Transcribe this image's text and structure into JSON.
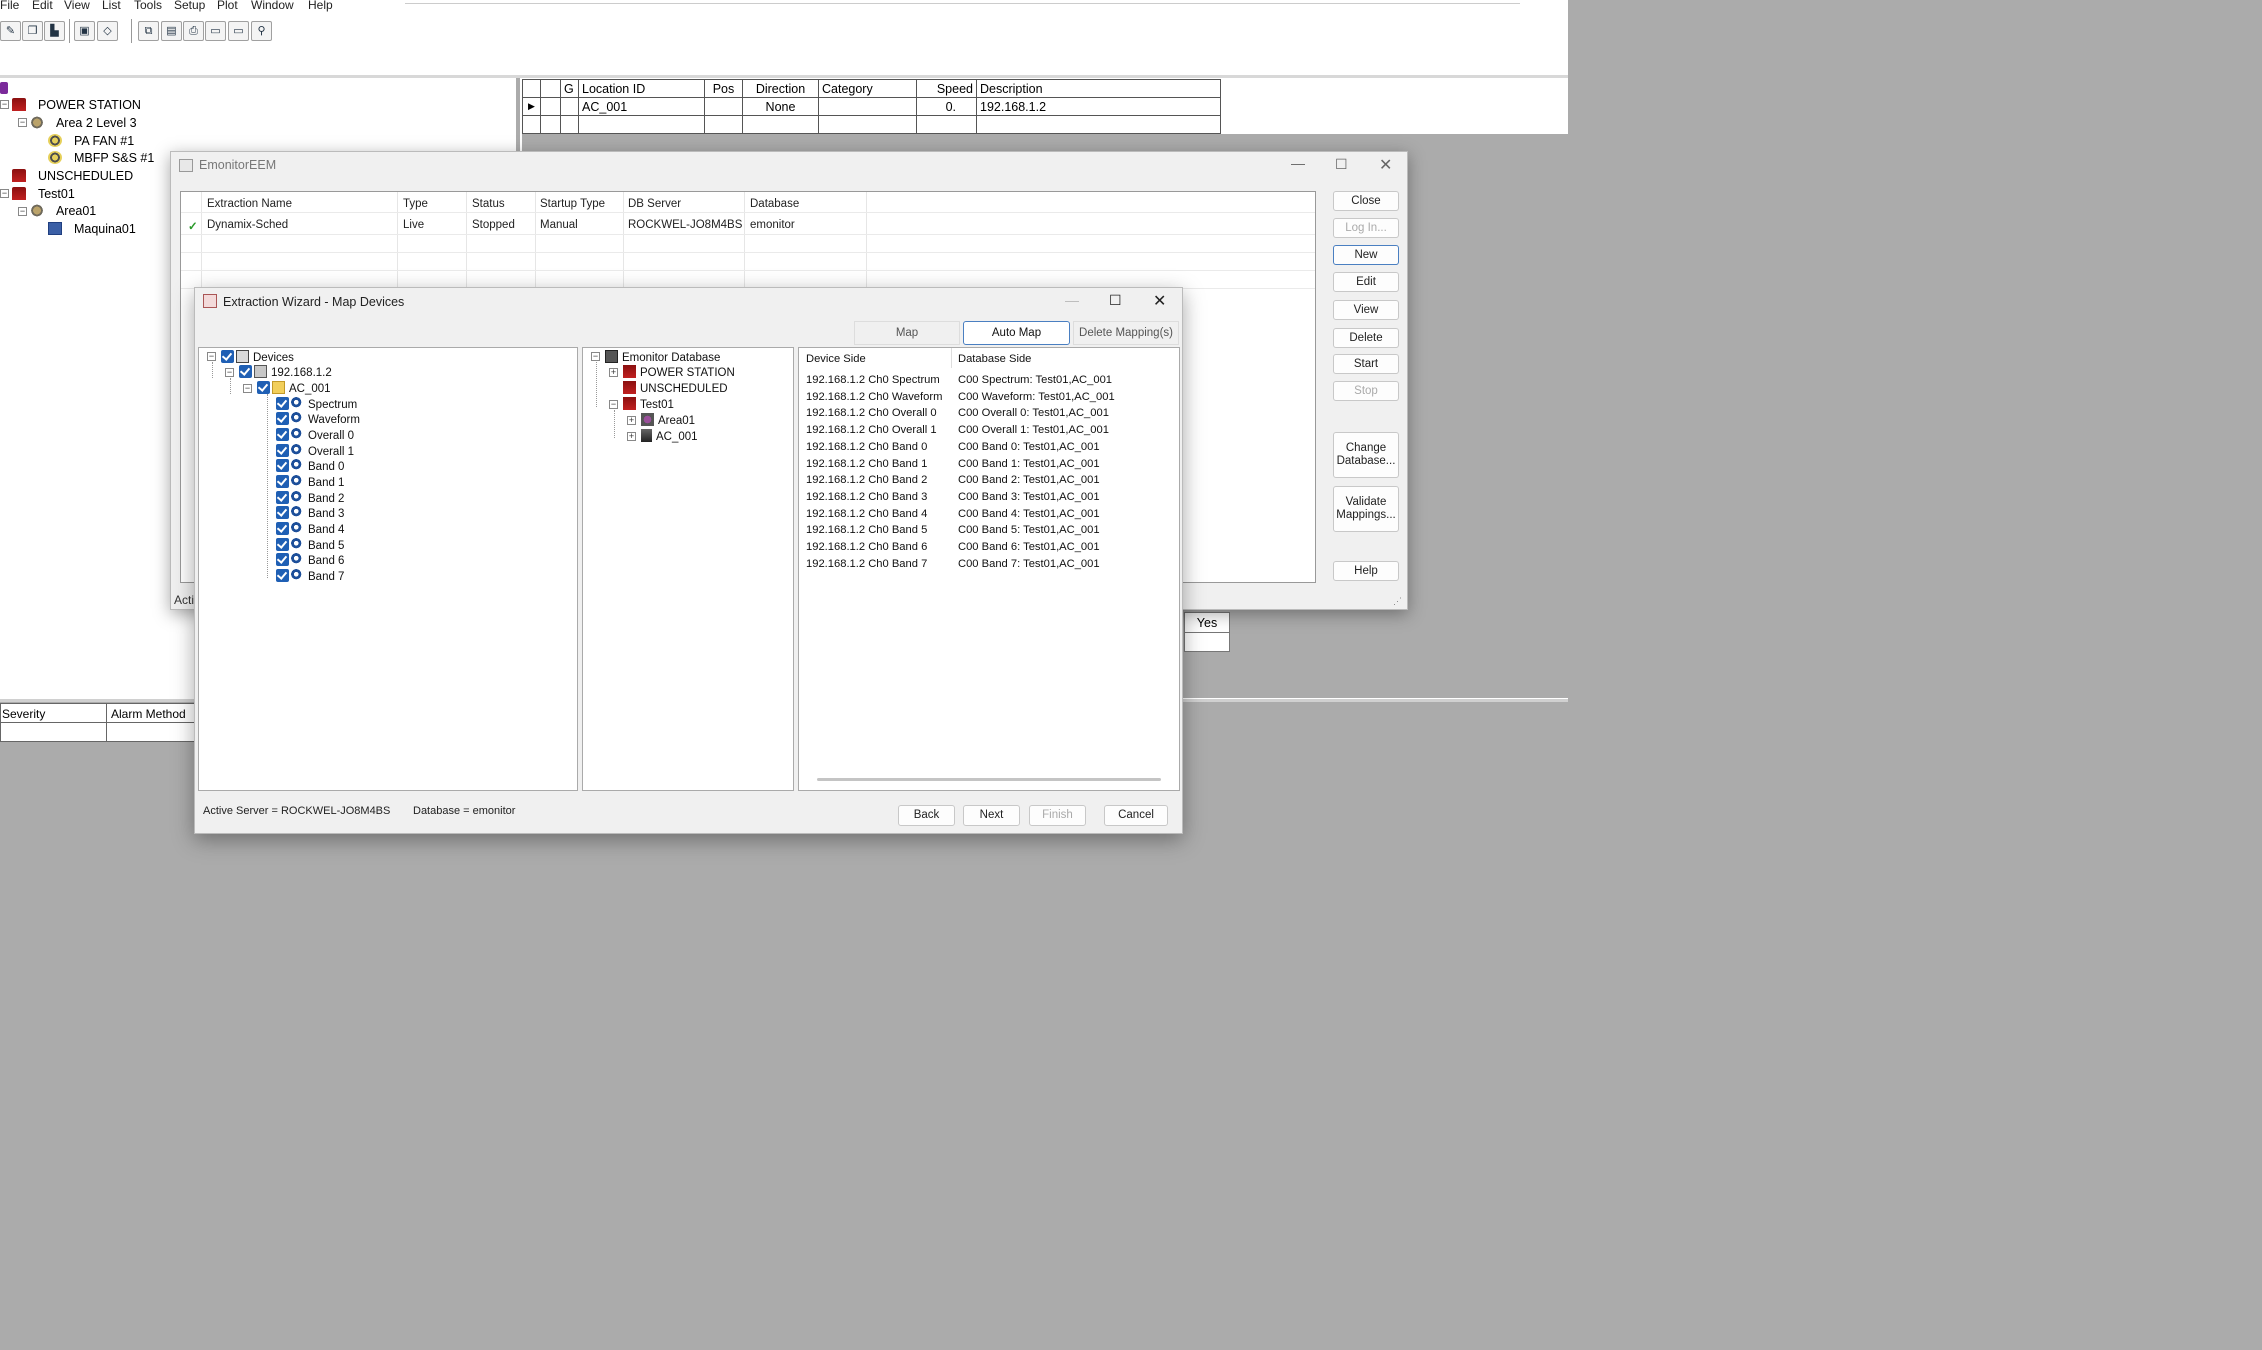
{
  "menu": [
    "File",
    "Edit",
    "View",
    "List",
    "Tools",
    "Setup",
    "Plot",
    "Window",
    "Help"
  ],
  "left_tree": [
    {
      "label": "POWER STATION",
      "icon": "station-icon"
    },
    {
      "label": "Area 2 Level 3",
      "icon": "area-icon"
    },
    {
      "label": "PA FAN #1",
      "icon": "fan-icon"
    },
    {
      "label": "MBFP S&S #1",
      "icon": "fan-icon"
    },
    {
      "label": "UNSCHEDULED",
      "icon": "station-icon"
    },
    {
      "label": "Test01",
      "icon": "station-icon"
    },
    {
      "label": "Area01",
      "icon": "area-icon"
    },
    {
      "label": "Maquina01",
      "icon": "machine-icon"
    }
  ],
  "location_grid": {
    "headers": [
      "G",
      "Location ID",
      "Pos",
      "Direction",
      "Category",
      "Speed",
      "Description"
    ],
    "row": {
      "location_id": "AC_001",
      "pos": "",
      "direction": "None",
      "category": "",
      "speed": "0.",
      "description": "192.168.1.2"
    }
  },
  "alarm_grid": {
    "headers": [
      "Severity",
      "Alarm Method"
    ]
  },
  "background_yes": "Yes",
  "eem": {
    "title": "EmonitorEEM",
    "table_headers": [
      "Extraction Name",
      "Type",
      "Status",
      "Startup Type",
      "DB Server",
      "Database"
    ],
    "row": {
      "name": "Dynamix-Sched",
      "type": "Live",
      "status": "Stopped",
      "startup": "Manual",
      "server": "ROCKWEL-JO8M4BS",
      "database": "emonitor"
    },
    "check_mark": "✓",
    "acti_text": "Acti",
    "buttons": {
      "close": "Close",
      "login": "Log In...",
      "new": "New",
      "edit": "Edit",
      "view": "View",
      "delete": "Delete",
      "start": "Start",
      "stop": "Stop",
      "change_db_1": "Change",
      "change_db_2": "Database...",
      "validate_1": "Validate",
      "validate_2": "Mappings...",
      "help": "Help"
    }
  },
  "wizard": {
    "title": "Extraction Wizard - Map Devices",
    "tabs": {
      "map": "Map",
      "auto_map": "Auto Map",
      "delete": "Delete Mapping(s)"
    },
    "devices": {
      "root": "Devices",
      "ip": "192.168.1.2",
      "folder": "AC_001",
      "signals": [
        "Spectrum",
        "Waveform",
        "Overall 0",
        "Overall 1",
        "Band 0",
        "Band 1",
        "Band 2",
        "Band 3",
        "Band 4",
        "Band 5",
        "Band 6",
        "Band 7"
      ]
    },
    "db_tree": {
      "root": "Emonitor Database",
      "items": [
        "POWER STATION",
        "UNSCHEDULED",
        "Test01"
      ],
      "sub": [
        "Area01",
        "AC_001"
      ]
    },
    "mapping": {
      "headers": {
        "device": "Device Side",
        "database": "Database Side"
      },
      "rows": [
        {
          "device": "192.168.1.2 Ch0 Spectrum",
          "database": "C00 Spectrum: Test01,AC_001"
        },
        {
          "device": "192.168.1.2 Ch0 Waveform",
          "database": "C00 Waveform: Test01,AC_001"
        },
        {
          "device": "192.168.1.2 Ch0 Overall 0",
          "database": "C00 Overall 0: Test01,AC_001"
        },
        {
          "device": "192.168.1.2 Ch0 Overall 1",
          "database": "C00 Overall 1: Test01,AC_001"
        },
        {
          "device": "192.168.1.2 Ch0 Band 0",
          "database": "C00 Band 0: Test01,AC_001"
        },
        {
          "device": "192.168.1.2 Ch0 Band 1",
          "database": "C00 Band 1: Test01,AC_001"
        },
        {
          "device": "192.168.1.2 Ch0 Band 2",
          "database": "C00 Band 2: Test01,AC_001"
        },
        {
          "device": "192.168.1.2 Ch0 Band 3",
          "database": "C00 Band 3: Test01,AC_001"
        },
        {
          "device": "192.168.1.2 Ch0 Band 4",
          "database": "C00 Band 4: Test01,AC_001"
        },
        {
          "device": "192.168.1.2 Ch0 Band 5",
          "database": "C00 Band 5: Test01,AC_001"
        },
        {
          "device": "192.168.1.2 Ch0 Band 6",
          "database": "C00 Band 6: Test01,AC_001"
        },
        {
          "device": "192.168.1.2 Ch0 Band 7",
          "database": "C00 Band 7: Test01,AC_001"
        }
      ]
    },
    "status": {
      "server": "Active Server = ROCKWEL-JO8M4BS",
      "database": "Database = emonitor"
    },
    "buttons": {
      "back": "Back",
      "next": "Next",
      "finish": "Finish",
      "cancel": "Cancel"
    }
  }
}
